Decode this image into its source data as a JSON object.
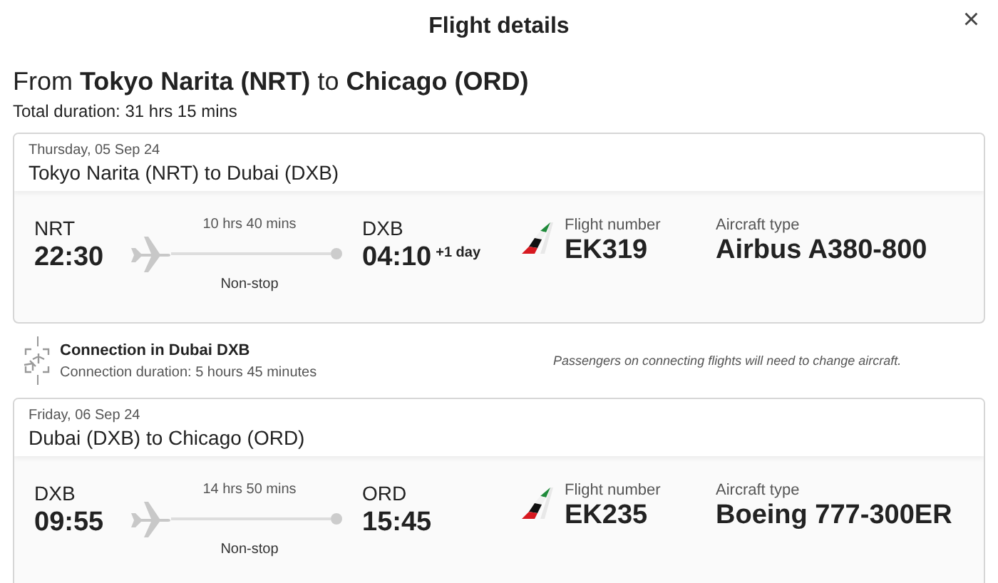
{
  "dialog": {
    "title": "Flight details",
    "close": "×"
  },
  "heading": "From **Tokyo Narita (NRT)** to **Chicago (ORD)**",
  "total_duration": "Total duration: 31 hrs 15 mins",
  "segments": [
    {
      "date": "Thursday, 05 Sep 24",
      "route": "Tokyo Narita (NRT) to Dubai (DXB)",
      "departure": {
        "code": "NRT",
        "time": "22:30"
      },
      "duration": "10 hrs 40 mins",
      "stops": "Non-stop",
      "arrival": {
        "code": "DXB",
        "time": "04:10",
        "day_offset": "+1 day"
      },
      "flight_number_label": "Flight number",
      "flight_number": "EK319",
      "aircraft_label": "Aircraft type",
      "aircraft": "Airbus A380-800"
    },
    {
      "date": "Friday, 06 Sep 24",
      "route": "Dubai (DXB) to Chicago (ORD)",
      "departure": {
        "code": "DXB",
        "time": "09:55"
      },
      "duration": "14 hrs 50 mins",
      "stops": "Non-stop",
      "arrival": {
        "code": "ORD",
        "time": "15:45"
      },
      "flight_number_label": "Flight number",
      "flight_number": "EK235",
      "aircraft_label": "Aircraft type",
      "aircraft": "Boeing 777-300ER"
    }
  ],
  "connection": {
    "title": "Connection in Dubai DXB",
    "duration": "Connection duration: 5 hours 45 minutes",
    "note": "Passengers on connecting flights will need to change aircraft."
  }
}
